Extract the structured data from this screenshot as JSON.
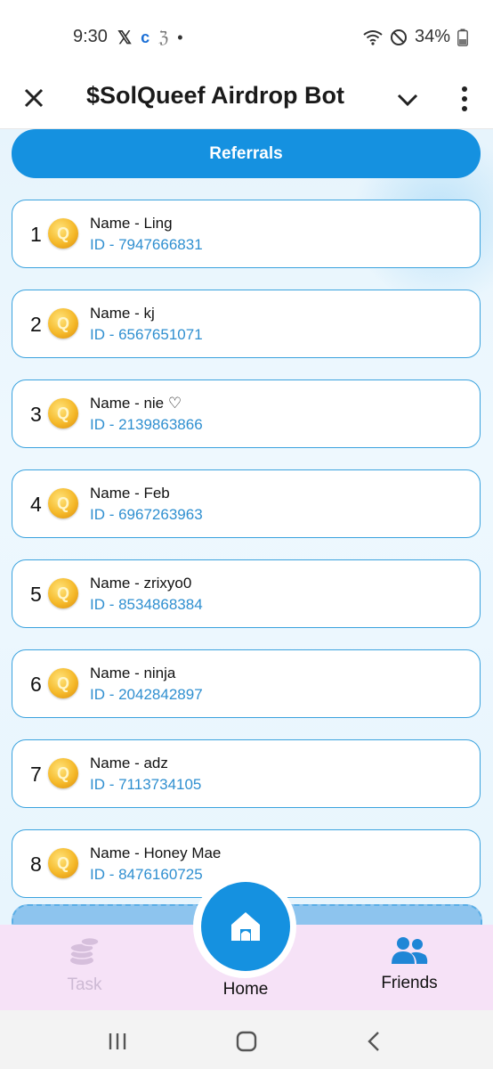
{
  "status_bar": {
    "time": "9:30",
    "battery": "34%",
    "left_icons": [
      "x-logo-icon",
      "app-c-icon",
      "app-3-icon",
      "dot-icon"
    ],
    "right_icons": [
      "wifi-icon",
      "do-not-disturb-icon",
      "battery-icon"
    ]
  },
  "header": {
    "title": "$SolQueef Airdrop Bot"
  },
  "referrals_button": "Referrals",
  "referrals": [
    {
      "rank": "1",
      "name": "Name - Ling",
      "id": "ID - 7947666831"
    },
    {
      "rank": "2",
      "name": "Name - kj",
      "id": "ID - 6567651071"
    },
    {
      "rank": "3",
      "name": "Name - nie ♡",
      "id": "ID - 2139863866"
    },
    {
      "rank": "4",
      "name": "Name - Feb",
      "id": "ID - 6967263963"
    },
    {
      "rank": "5",
      "name": "Name - zrixyo0",
      "id": "ID - 8534868384"
    },
    {
      "rank": "6",
      "name": "Name - ninja",
      "id": "ID - 2042842897"
    },
    {
      "rank": "7",
      "name": "Name - adz",
      "id": "ID - 7113734105"
    },
    {
      "rank": "8",
      "name": "Name - Honey Mae",
      "id": "ID - 8476160725"
    }
  ],
  "coin_letter": "Q",
  "bottom_nav": {
    "task": "Task",
    "home": "Home",
    "friends": "Friends"
  },
  "colors": {
    "accent": "#1591e0",
    "card_border": "#3aa2de",
    "id_text": "#2f8fd0",
    "nav_bg": "#f6e2f7",
    "task_inactive": "#cdbad4"
  }
}
